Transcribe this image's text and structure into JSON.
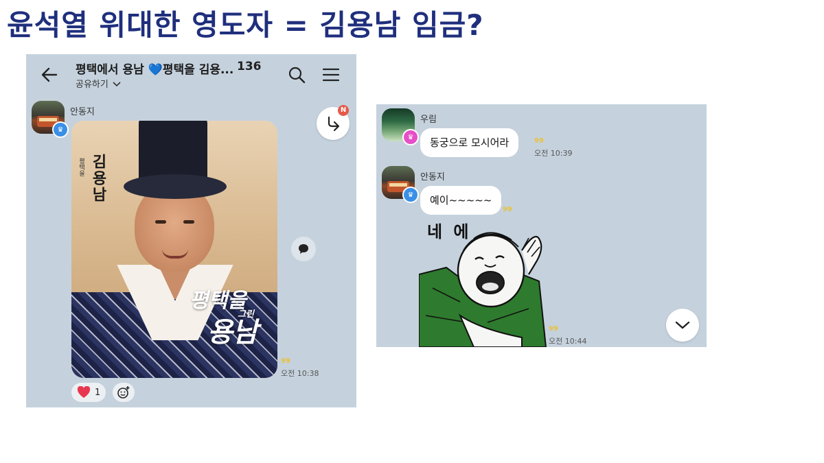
{
  "headline": "윤석열 위대한 영도자 = 김용남 임금?",
  "left_chat": {
    "title_prefix": "평택에서 용남 ",
    "title_heart": "💙",
    "title_suffix": "평택을 김용...",
    "member_count": "136",
    "share_label": "공유하기",
    "message": {
      "sender": "안동지",
      "poster": {
        "small_label": "평택을",
        "name": "김용남",
        "calligraphy_line1": "평택을",
        "calligraphy_line2": "그린",
        "calligraphy_line3": "용남"
      },
      "read_count": "99",
      "time": "오전 10:38",
      "reaction_count": "1",
      "new_badge": "N"
    }
  },
  "right_chat": {
    "messages": [
      {
        "sender": "우림",
        "text": "동궁으로 모시어라",
        "read_count": "99",
        "time": "오전 10:39"
      },
      {
        "sender": "안동지",
        "text": "예이~~~~~",
        "read_count": "99"
      }
    ],
    "sticker": {
      "text": "네 에",
      "read_count": "99",
      "time": "오전 10:44"
    }
  },
  "colors": {
    "headline": "#1f2f7d",
    "chat_background": "#c5d2dd",
    "read_count": "#e8c23c"
  }
}
